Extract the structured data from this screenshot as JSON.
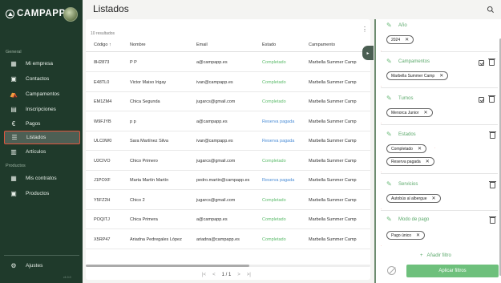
{
  "app": {
    "name": "CAMPAPP",
    "version": "v1.0.0"
  },
  "page": {
    "title": "Listados"
  },
  "sidebar": {
    "section_gestion": "General",
    "items": [
      {
        "label": "Mi empresa",
        "icon": "building-icon"
      },
      {
        "label": "Contactos",
        "icon": "contacts-icon"
      },
      {
        "label": "Campamentos",
        "icon": "tent-icon"
      },
      {
        "label": "Inscripciones",
        "icon": "document-icon"
      },
      {
        "label": "Pagos",
        "icon": "euro-icon"
      },
      {
        "label": "Listados",
        "icon": "list-icon"
      },
      {
        "label": "Artículos",
        "icon": "articles-icon"
      }
    ],
    "section_productos": "Productos",
    "product_items": [
      {
        "label": "Mis contratos",
        "icon": "contract-icon"
      },
      {
        "label": "Productos",
        "icon": "product-icon"
      }
    ],
    "settings_label": "Ajustes"
  },
  "table": {
    "results_count": "10 resultados",
    "columns": [
      "Código",
      "Nombre",
      "Email",
      "Estado",
      "Campamento"
    ],
    "sort_indicator": "↑",
    "rows": [
      {
        "codigo": "8H2873",
        "nombre": "P P",
        "email": "a@campapp.es",
        "estado": "Completado",
        "campamento": "Marbella Summer Camp"
      },
      {
        "codigo": "E48TL0",
        "nombre": "Victor Maiso Irigay",
        "email": "ivan@campapp.es",
        "estado": "Completado",
        "campamento": "Marbella Summer Camp"
      },
      {
        "codigo": "EM1ZM4",
        "nombre": "Chica Segunda",
        "email": "jugarcs@gmail.com",
        "estado": "Completado",
        "campamento": "Marbella Summer Camp"
      },
      {
        "codigo": "W9FJYB",
        "nombre": "p p",
        "email": "a@campapp.es",
        "estado": "Reserva pagada",
        "campamento": "Marbella Summer Camp"
      },
      {
        "codigo": "ULC0W0",
        "nombre": "Sara Martínez Silva",
        "email": "ivan@campapp.es",
        "estado": "Reserva pagada",
        "campamento": "Marbella Summer Camp"
      },
      {
        "codigo": "U2CIVO",
        "nombre": "Chico Primero",
        "email": "jugarcs@gmail.com",
        "estado": "Completado",
        "campamento": "Marbella Summer Camp"
      },
      {
        "codigo": "J1POXF",
        "nombre": "Marta Martín Martín",
        "email": "pedro.martin@campapp.es",
        "estado": "Reserva pagada",
        "campamento": "Marbella Summer Camp"
      },
      {
        "codigo": "Y5FZ2H",
        "nombre": "Chico 2",
        "email": "jugarcs@gmail.com",
        "estado": "Completado",
        "campamento": "Marbella Summer Camp"
      },
      {
        "codigo": "POQITJ",
        "nombre": "Chica Primera",
        "email": "a@campapp.es",
        "estado": "Completado",
        "campamento": "Marbella Summer Camp"
      },
      {
        "codigo": "X5RP47",
        "nombre": "Ariadna Pedregales López",
        "email": "ariadna@campapp.es",
        "estado": "Completado",
        "campamento": "Marbella Summer Camp"
      }
    ],
    "pager": {
      "current": "1",
      "total": "1",
      "separator": "/"
    }
  },
  "filters": {
    "groups": [
      {
        "label": "Año",
        "chips": [
          "2024"
        ]
      },
      {
        "label": "Campamentos",
        "chips": [
          "Marbella Summer Camp"
        ]
      },
      {
        "label": "Turnos",
        "chips": [
          "Menorca Junior"
        ]
      },
      {
        "label": "Estados",
        "chips": [
          "Completado",
          "Reserva pagada"
        ]
      },
      {
        "label": "Servicios",
        "chips": [
          "Autobús al albergue"
        ]
      },
      {
        "label": "Modo de pago",
        "chips": [
          "Pago único"
        ]
      }
    ],
    "add_filter_label": "Añadir filtro",
    "apply_label": "Aplicar filtros"
  },
  "colors": {
    "sidebar_bg": "#1f3a2b",
    "accent_green": "#6ec07c",
    "active_border": "#e0553d",
    "status_completed": "#5bbb6a",
    "status_reserva": "#4d8ed6"
  }
}
